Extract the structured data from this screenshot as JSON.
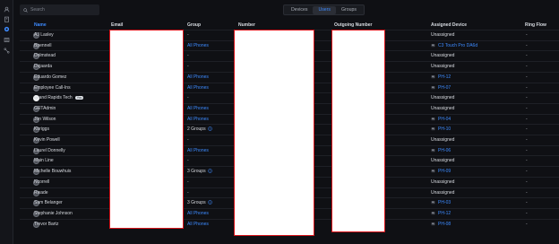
{
  "rail": {
    "icons": [
      "users-icon",
      "building-icon",
      "phone-icon",
      "list-icon",
      "routing-icon"
    ]
  },
  "search": {
    "placeholder": "Search"
  },
  "tabs": [
    {
      "label": "Devices",
      "active": false
    },
    {
      "label": "Users",
      "active": true
    },
    {
      "label": "Groups",
      "active": false
    }
  ],
  "columns": {
    "name": "Name",
    "email": "Email",
    "group": "Group",
    "number": "Number",
    "outgoing": "Outgoing Number",
    "device": "Assigned Device",
    "ring": "Ring Flow"
  },
  "rows": [
    {
      "name": "AJ Lasley",
      "group": "-",
      "device": "Unassigned",
      "ring": "-",
      "avatar": "gray"
    },
    {
      "name": "Bpennell",
      "group": "All Phones",
      "device": "C3 Touch Pro DA6d",
      "ring": "-",
      "avatar": "gray"
    },
    {
      "name": "Dolmstead",
      "group": "-",
      "device": "Unassigned",
      "ring": "-",
      "avatar": "gray"
    },
    {
      "name": "Dsjaarda",
      "group": "-",
      "device": "Unassigned",
      "ring": "-",
      "avatar": "gray"
    },
    {
      "name": "Eduardo Gomez",
      "group": "All Phones",
      "device": "PH-12",
      "ring": "-",
      "avatar": "gray"
    },
    {
      "name": "Employee Call-Ins",
      "group": "All Phones",
      "device": "PH-07",
      "ring": "-",
      "avatar": "gray"
    },
    {
      "name": "Grand Rapids Tech",
      "badge": "You",
      "group": "-",
      "device": "Unassigned",
      "ring": "-",
      "avatar": "white"
    },
    {
      "name": "GRTAdmin",
      "group": "All Phones",
      "device": "Unassigned",
      "ring": "-",
      "avatar": "gray"
    },
    {
      "name": "Jon Wilson",
      "group": "All Phones",
      "device": "PH-04",
      "ring": "-",
      "avatar": "gray"
    },
    {
      "name": "Kbriggs",
      "group": "2 Groups",
      "device": "PH-10",
      "ring": "-",
      "avatar": "gray"
    },
    {
      "name": "Kevin Powell",
      "group": "-",
      "device": "Unassigned",
      "ring": "-",
      "avatar": "gray"
    },
    {
      "name": "Laurel Donnelly",
      "group": "All Phones",
      "device": "PH-06",
      "ring": "-",
      "avatar": "gray"
    },
    {
      "name": "Main Line",
      "group": "-",
      "device": "Unassigned",
      "ring": "-",
      "avatar": "gray"
    },
    {
      "name": "Michelle Bouwhuis",
      "group": "3 Groups",
      "device": "PH-09",
      "ring": "-",
      "avatar": "gray"
    },
    {
      "name": "Ncorrell",
      "group": "-",
      "device": "Unassigned",
      "ring": "-",
      "avatar": "gray"
    },
    {
      "name": "Rwade",
      "group": "-",
      "device": "Unassigned",
      "ring": "-",
      "avatar": "gray"
    },
    {
      "name": "Sam Belanger",
      "group": "3 Groups",
      "device": "PH-03",
      "ring": "-",
      "avatar": "gray"
    },
    {
      "name": "Stephanie Johnson",
      "group": "All Phones",
      "device": "PH-12",
      "ring": "-",
      "avatar": "gray"
    },
    {
      "name": "Trevor Bartz",
      "group": "All Phones",
      "device": "PH-08",
      "ring": "-",
      "avatar": "gray"
    }
  ],
  "colors": {
    "accent": "#3d8bff",
    "background": "#0f1014",
    "redaction_border": "#d8141a"
  }
}
